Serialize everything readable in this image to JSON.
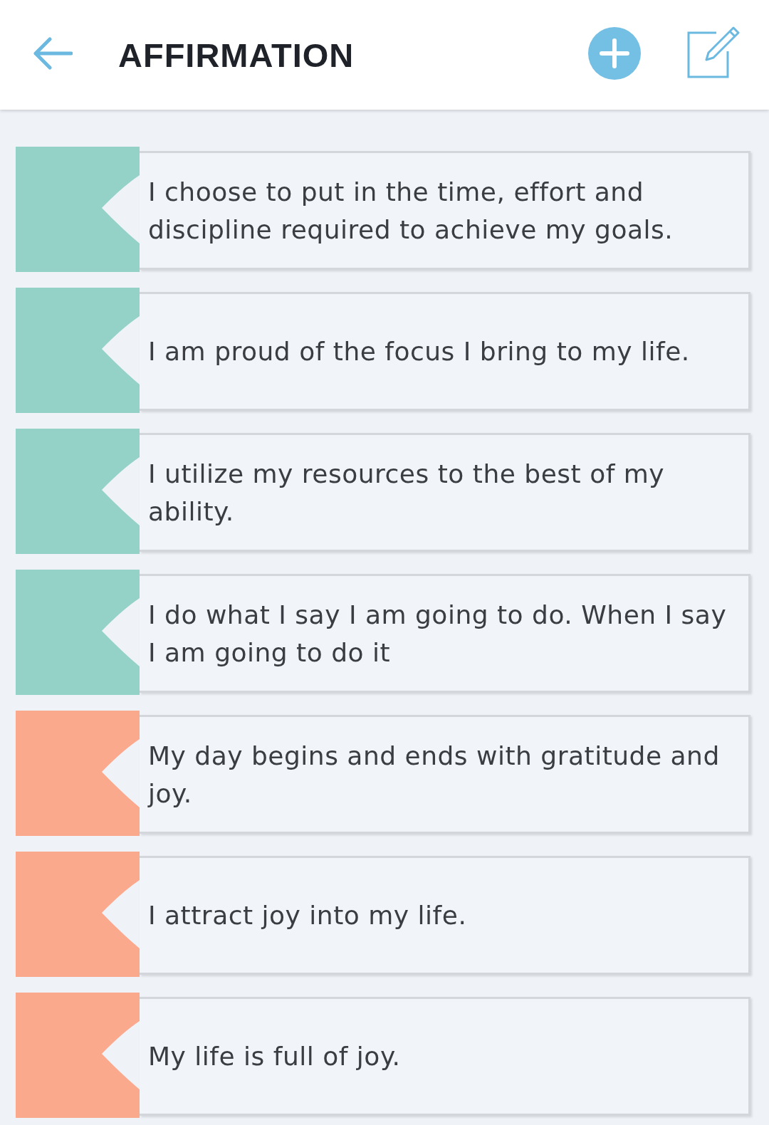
{
  "header": {
    "title": "AFFIRMATION"
  },
  "affirmations": [
    {
      "text": "I choose to put in the time, effort and discipline required to achieve my goals.",
      "color": "#94d1c7"
    },
    {
      "text": "I am proud of the focus I bring to my life.",
      "color": "#94d1c7"
    },
    {
      "text": "I utilize my resources to the best of my ability.",
      "color": "#94d1c7"
    },
    {
      "text": "I do what I say I am going to do. When I say I am going to do it",
      "color": "#94d1c7"
    },
    {
      "text": "My day begins and ends with gratitude and joy.",
      "color": "#fba98d"
    },
    {
      "text": "I attract joy into my life.",
      "color": "#fba98d"
    },
    {
      "text": "My life is full of joy.",
      "color": "#fba98d"
    }
  ]
}
